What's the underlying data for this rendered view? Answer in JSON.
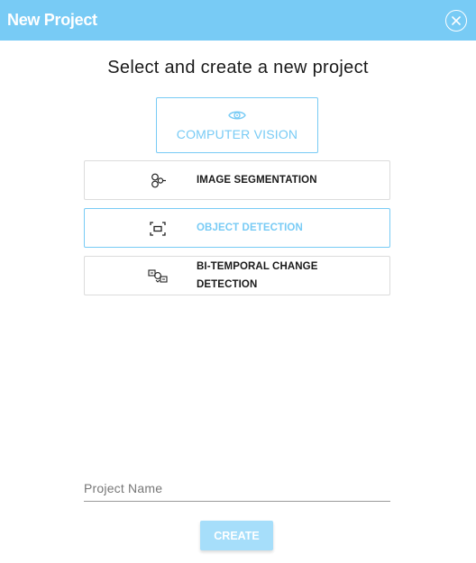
{
  "header": {
    "title": "New Project"
  },
  "heading": "Select and create a new project",
  "category": {
    "label": "COMPUTER VISION",
    "icon": "eye-icon"
  },
  "options": [
    {
      "label": "IMAGE SEGMENTATION",
      "icon": "segmentation-icon",
      "selected": false
    },
    {
      "label": "OBJECT DETECTION",
      "icon": "bounding-box-icon",
      "selected": true
    },
    {
      "label": "BI-TEMPORAL CHANGE DETECTION",
      "icon": "change-detection-icon",
      "selected": false
    }
  ],
  "project_name": {
    "placeholder": "Project Name",
    "value": ""
  },
  "create_label": "CREATE",
  "colors": {
    "accent": "#78cbf5",
    "button_disabled": "#a6defa",
    "border": "#dcdcdc"
  }
}
